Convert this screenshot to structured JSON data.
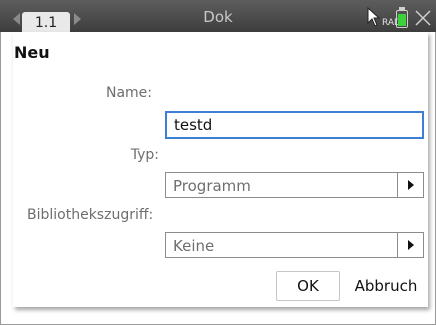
{
  "status_bar": {
    "tab_label": "1.1",
    "document_title": "Dok",
    "mode_label": "RAD",
    "battery_color": "#3bd23b",
    "icons": [
      "chevron-left-icon",
      "chevron-right-icon",
      "cursor-icon",
      "battery-icon",
      "close-icon"
    ]
  },
  "dialog": {
    "title": "Neu",
    "name_label": "Name:",
    "name_value": "testd",
    "type_label": "Typ:",
    "type_value": "Programm",
    "library_label": "Bibliothekszugriff:",
    "library_value": "Keine",
    "ok_label": "OK",
    "cancel_label": "Abbruch",
    "focus_color": "#3d7ed6"
  }
}
